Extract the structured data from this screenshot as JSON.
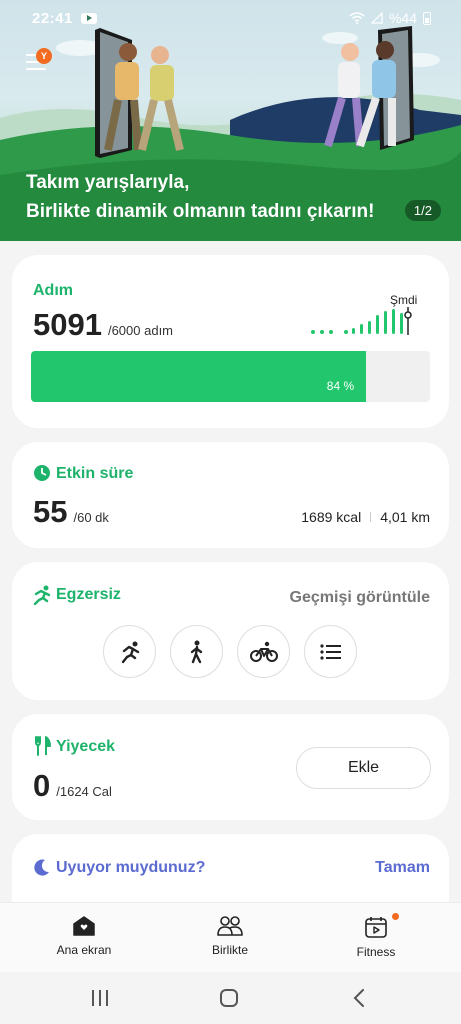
{
  "status": {
    "time": "22:41",
    "battery": "%44"
  },
  "banner": {
    "avatar_letter": "Y",
    "line1": "Takım yarışlarıyla,",
    "line2": "Birlikte dinamik olmanın tadını çıkarın!",
    "page": "1/2"
  },
  "steps": {
    "label": "Adım",
    "value": "5091",
    "goal": "/6000 adım",
    "now_label": "Şmdi",
    "percent_text": "84 %",
    "progress_fraction": 0.84
  },
  "active": {
    "label": "Etkin süre",
    "value": "55",
    "goal": "/60 dk",
    "kcal": "1689 kcal",
    "km": "4,01 km"
  },
  "exercise": {
    "label": "Egzersiz",
    "history": "Geçmişi görüntüle",
    "icons": [
      "running-icon",
      "walking-icon",
      "cycling-icon",
      "list-icon"
    ]
  },
  "food": {
    "label": "Yiyecek",
    "value": "0",
    "goal": "/1624 Cal",
    "add": "Ekle"
  },
  "sleep": {
    "label": "Uyuyor muydunuz?",
    "ok": "Tamam"
  },
  "nav": {
    "home": "Ana ekran",
    "together": "Birlikte",
    "fitness": "Fitness"
  },
  "colors": {
    "accent": "#1eb36b",
    "progress": "#22c76d",
    "sleep": "#5b6bd0",
    "badge": "#f26b21"
  }
}
